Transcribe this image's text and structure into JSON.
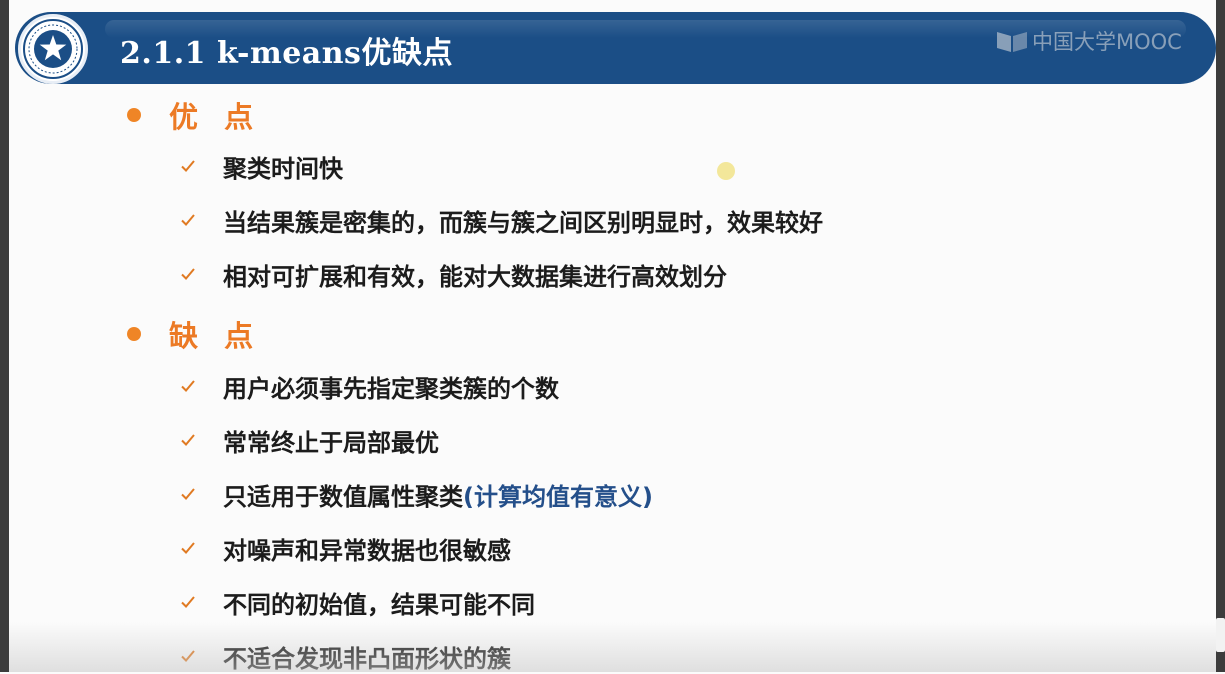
{
  "header": {
    "title": "2.1.1 k-means优缺点",
    "watermark": "中国大学MOOC",
    "logo_icon": "university-seal-icon"
  },
  "colors": {
    "header_bg": "#1b4e86",
    "section_title": "#ec7a25",
    "bullet": "#ef8526",
    "check": "#e07a22",
    "note_text": "#244f8a"
  },
  "sections": [
    {
      "title": "优 点",
      "items": [
        {
          "text": "聚类时间快"
        },
        {
          "text": "当结果簇是密集的，而簇与簇之间区别明显时，效果较好"
        },
        {
          "text": "相对可扩展和有效，能对大数据集进行高效划分"
        }
      ]
    },
    {
      "title": "缺 点",
      "items": [
        {
          "text": "用户必须事先指定聚类簇的个数"
        },
        {
          "text": "常常终止于局部最优"
        },
        {
          "text": "只适用于数值属性聚类",
          "note": "(计算均值有意义)"
        },
        {
          "text": "对噪声和异常数据也很敏感"
        },
        {
          "text": "不同的初始值，结果可能不同"
        },
        {
          "text": "不适合发现非凸面形状的簇"
        }
      ]
    }
  ]
}
